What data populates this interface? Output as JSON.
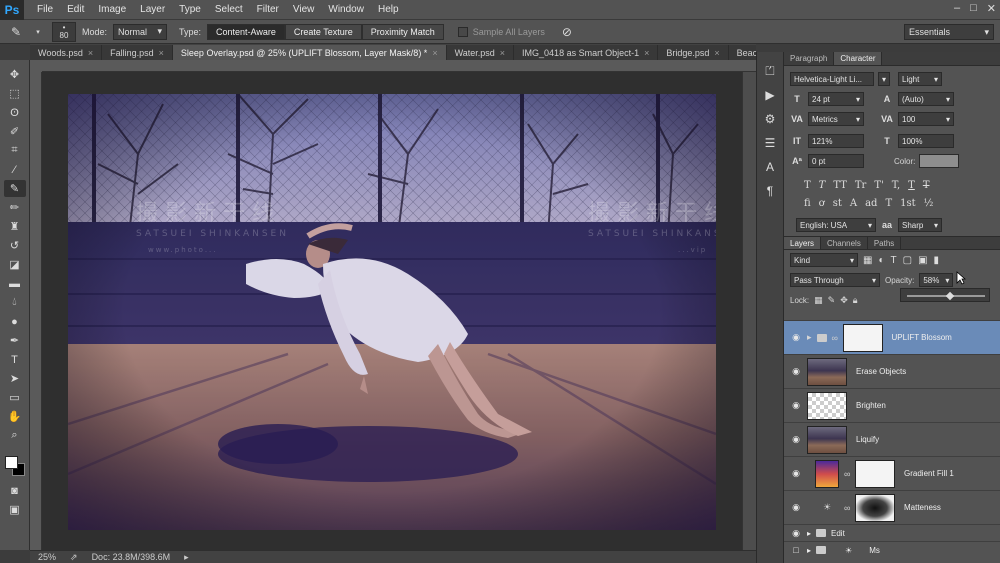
{
  "menubar": {
    "logo": "Ps",
    "items": [
      "File",
      "Edit",
      "Image",
      "Layer",
      "Type",
      "Select",
      "Filter",
      "View",
      "Window",
      "Help"
    ],
    "controls": [
      "–",
      "□",
      "✕"
    ]
  },
  "options": {
    "brush_size": "80",
    "mode_label": "Mode:",
    "mode_value": "Normal",
    "type_label": "Type:",
    "type_buttons": [
      "Content-Aware",
      "Create Texture",
      "Proximity Match"
    ],
    "sample_all": "Sample All Layers",
    "workspace": "Essentials"
  },
  "tabs": [
    {
      "label": "Woods.psd",
      "active": false
    },
    {
      "label": "Falling.psd",
      "active": false
    },
    {
      "label": "Sleep Overlay.psd @ 25% (UPLIFT Blossom, Layer Mask/8) *",
      "active": true
    },
    {
      "label": "Water.psd",
      "active": false
    },
    {
      "label": "IMG_0418 as Smart Object-1",
      "active": false
    },
    {
      "label": "Bridge.psd",
      "active": false
    },
    {
      "label": "Beach.p",
      "active": false
    }
  ],
  "watermark": {
    "left_cn": "撮 影 新 干 线",
    "left_en": "SATSUEI SHINKANSEN",
    "left_url": "www.photo...",
    "right_cn": "撮 影 新 干 线",
    "right_en": "SATSUEI SHINKANSEN",
    "right_url": "...vip"
  },
  "status": {
    "zoom": "25%",
    "doc": "Doc: 23.8M/398.6M"
  },
  "character_panel": {
    "tabs": [
      "Paragraph",
      "Character"
    ],
    "font_family": "Helvetica-Light Li...",
    "font_style": "Light",
    "size": "24 pt",
    "leading": "(Auto)",
    "kerning": "Metrics",
    "tracking": "100",
    "vertical_scale": "121%",
    "horizontal_scale": "100%",
    "baseline": "0 pt",
    "color_label": "Color:",
    "type_styles_1": [
      "T",
      "T",
      "TT",
      "Tr",
      "T'",
      "T,",
      "T",
      "T"
    ],
    "type_styles_2": [
      "fi",
      "ơ",
      "st",
      "A",
      "ad",
      "T",
      "1st",
      "½"
    ],
    "language": "English: USA",
    "antialias": "Sharp"
  },
  "layers_panel": {
    "tabs": [
      "Layers",
      "Channels",
      "Paths"
    ],
    "filter": "Kind",
    "blend_mode": "Pass Through",
    "opacity_label": "Opacity:",
    "opacity": "58%",
    "lock_label": "Lock:",
    "layers": [
      {
        "name": "UPLIFT Blossom",
        "type": "group-mask",
        "selected": true
      },
      {
        "name": "Erase Objects",
        "type": "photo",
        "selected": false
      },
      {
        "name": "Brighten",
        "type": "checker",
        "selected": false
      },
      {
        "name": "Liquify",
        "type": "photo",
        "selected": false
      },
      {
        "name": "Gradient Fill 1",
        "type": "gradient",
        "selected": false
      },
      {
        "name": "Matteness",
        "type": "adjust",
        "selected": false
      }
    ],
    "groups": [
      "Edit",
      "Ms"
    ]
  }
}
